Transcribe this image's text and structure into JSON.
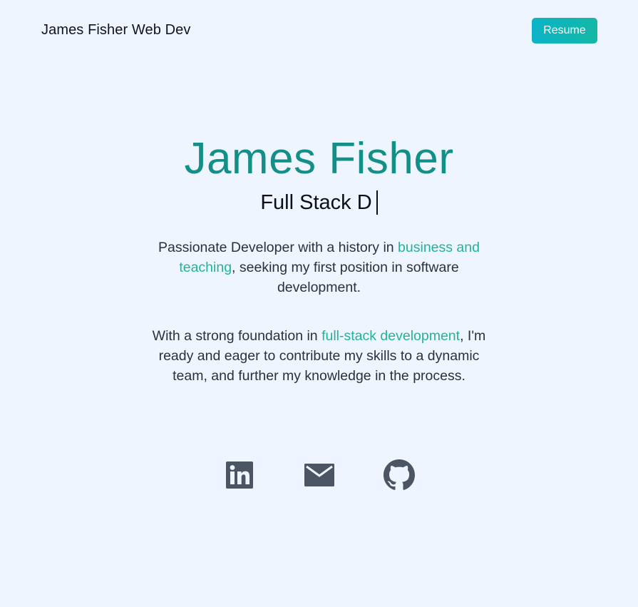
{
  "header": {
    "brand": "James Fisher Web Dev",
    "resume_label": "Resume"
  },
  "hero": {
    "name": "James Fisher",
    "role_typed": "Full Stack D"
  },
  "intro": {
    "p1_before": "Passionate Developer with a history in ",
    "p1_highlight": "business and teaching",
    "p1_after": ", seeking my first position in software development.",
    "p2_before": "With a strong foundation in ",
    "p2_highlight": "full-stack development",
    "p2_after": ", I'm ready and eager to contribute my skills to a dynamic team, and further my knowledge in the process."
  },
  "socials": [
    {
      "icon": "linkedin-icon"
    },
    {
      "icon": "mail-icon"
    },
    {
      "icon": "github-icon"
    }
  ],
  "colors": {
    "background": "#eff5fe",
    "accent": "#128f87",
    "highlight": "#22b39c",
    "button_start": "#0bb3c7",
    "button_end": "#14b8a6",
    "icon": "#4b5563"
  }
}
